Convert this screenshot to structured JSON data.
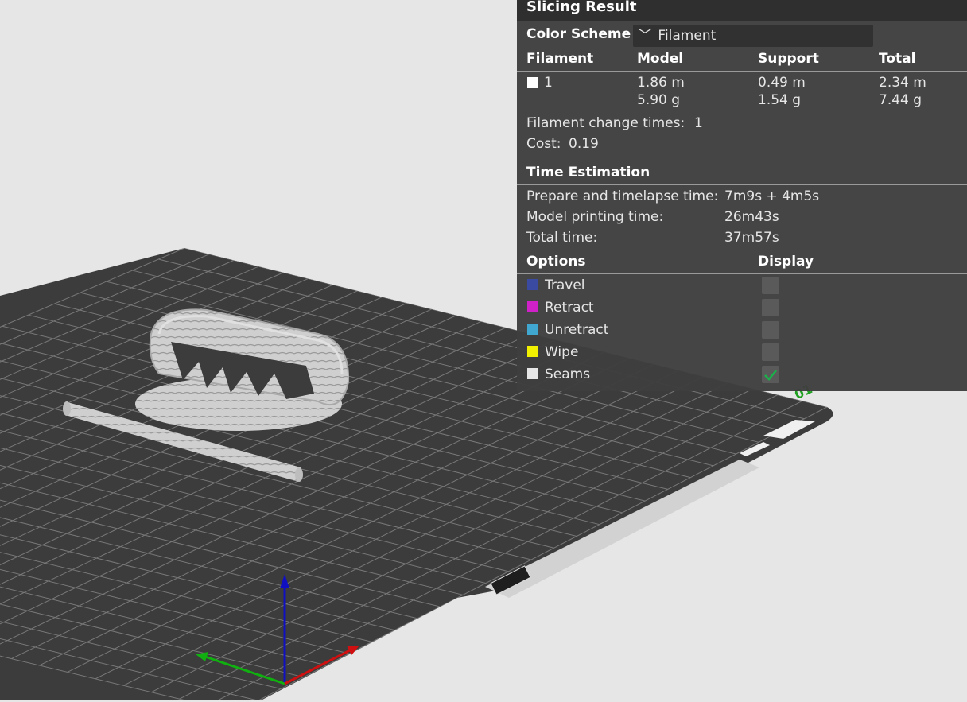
{
  "panel": {
    "title": "Slicing Result",
    "color_scheme_label": "Color Scheme",
    "color_scheme_value": "Filament",
    "headers": {
      "filament": "Filament",
      "model": "Model",
      "support": "Support",
      "total": "Total"
    },
    "filament_row": {
      "id": "1",
      "swatch_color": "#ffffff",
      "model_length": "1.86 m",
      "model_weight": "5.90 g",
      "support_length": "0.49 m",
      "support_weight": "1.54 g",
      "total_length": "2.34 m",
      "total_weight": "7.44 g"
    },
    "filament_change_label": "Filament change times:",
    "filament_change_value": "1",
    "cost_label": "Cost:",
    "cost_value": "0.19",
    "time_estimation_title": "Time Estimation",
    "prepare_label": "Prepare and timelapse time:",
    "prepare_value": "7m9s + 4m5s",
    "model_time_label": "Model printing time:",
    "model_time_value": "26m43s",
    "total_time_label": "Total time:",
    "total_time_value": "37m57s",
    "options_title": "Options",
    "display_title": "Display",
    "options": [
      {
        "label": "Travel",
        "color": "#3a4aa0",
        "checked": false
      },
      {
        "label": "Retract",
        "color": "#d020c8",
        "checked": false
      },
      {
        "label": "Unretract",
        "color": "#40a8d0",
        "checked": false
      },
      {
        "label": "Wipe",
        "color": "#f0f000",
        "checked": false
      },
      {
        "label": "Seams",
        "color": "#e6e6e6",
        "checked": true
      }
    ]
  },
  "scene": {
    "axis_colors": {
      "x": "#d01010",
      "y": "#10b010",
      "z": "#1010c0"
    },
    "plate_color": "#3c3c3c",
    "grid_color": "#8c8c8c",
    "model_color": "#c8c8c8"
  }
}
